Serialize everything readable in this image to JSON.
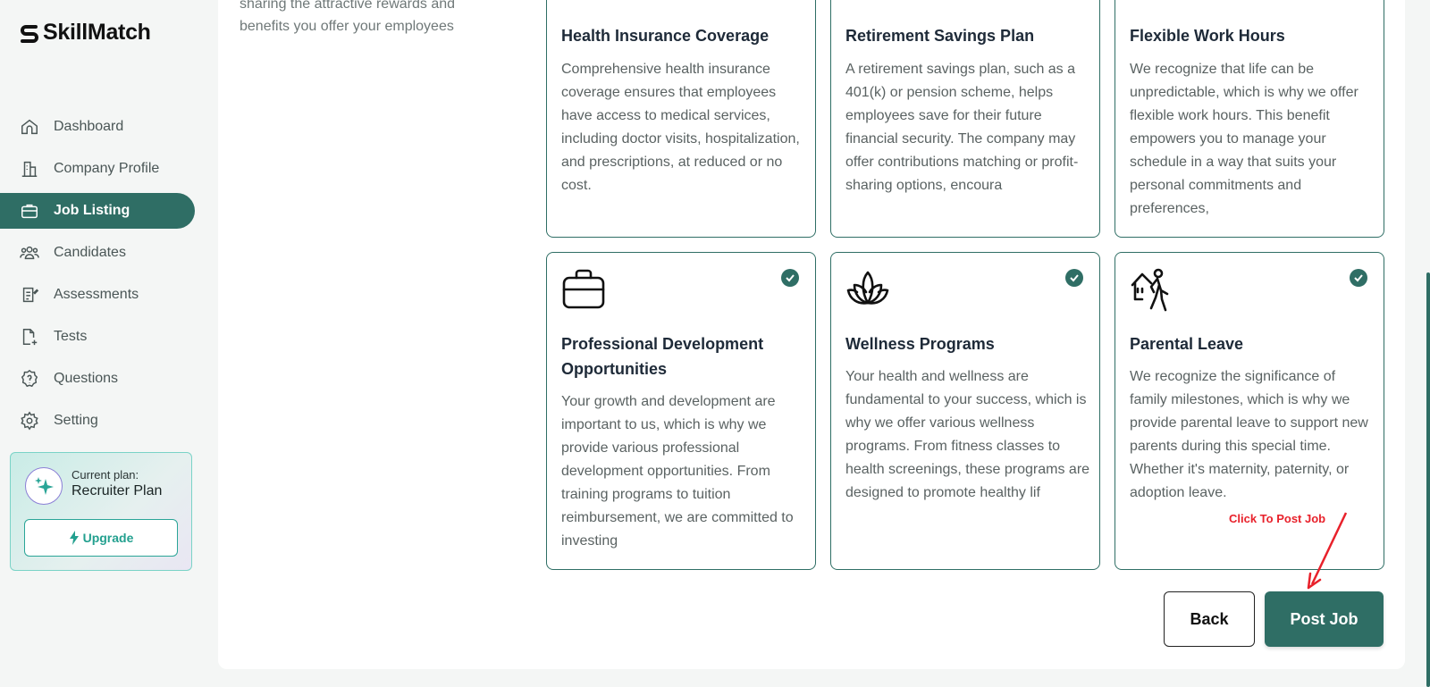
{
  "app": {
    "name": "SkillMatch"
  },
  "sidebar": {
    "items": [
      {
        "label": "Dashboard",
        "icon": "home-icon"
      },
      {
        "label": "Company Profile",
        "icon": "building-icon"
      },
      {
        "label": "Job Listing",
        "icon": "briefcase-icon",
        "active": true
      },
      {
        "label": "Candidates",
        "icon": "users-icon"
      },
      {
        "label": "Assessments",
        "icon": "clipboard-icon"
      },
      {
        "label": "Tests",
        "icon": "file-plus-icon"
      },
      {
        "label": "Questions",
        "icon": "question-icon"
      },
      {
        "label": "Setting",
        "icon": "gear-icon"
      }
    ],
    "plan": {
      "label": "Current plan:",
      "name": "Recruiter Plan",
      "upgrade_label": "Upgrade"
    }
  },
  "main": {
    "intro": "sharing the attractive rewards and benefits you offer your employees",
    "benefits": [
      {
        "title": "Health Insurance Coverage",
        "description": "Comprehensive health insurance coverage ensures that employees have access to medical services, including doctor visits, hospitalization, and prescriptions, at reduced or no cost."
      },
      {
        "title": "Retirement Savings Plan",
        "description": "A retirement savings plan, such as a 401(k) or pension scheme, helps employees save for their future financial security. The company may offer contributions matching or profit-sharing options, encoura"
      },
      {
        "title": "Flexible Work Hours",
        "description": "We recognize that life can be unpredictable, which is why we offer flexible work hours. This benefit empowers you to manage your schedule in a way that suits your personal commitments and preferences,"
      },
      {
        "title": "Professional Development Opportunities",
        "description": "Your growth and development are important to us, which is why we provide various professional development opportunities. From training programs to tuition reimbursement, we are committed to investing",
        "icon": "briefcase-icon",
        "selected": true
      },
      {
        "title": "Wellness Programs",
        "description": "Your health and wellness are fundamental to your success, which is why we offer various wellness programs. From fitness classes to health screenings, these programs are designed to promote healthy lif",
        "icon": "lotus-icon",
        "selected": true
      },
      {
        "title": "Parental Leave",
        "description": "We recognize the significance of family milestones, which is why we provide parental leave to support new parents during this special time. Whether it's maternity, paternity, or adoption leave.",
        "icon": "parent-walk-icon",
        "selected": true
      }
    ],
    "actions": {
      "back_label": "Back",
      "post_label": "Post Job"
    },
    "annotation": "Click To Post Job"
  },
  "colors": {
    "primary": "#2f6e65",
    "annotation": "#e8212b",
    "upgrade": "#23a08f"
  }
}
